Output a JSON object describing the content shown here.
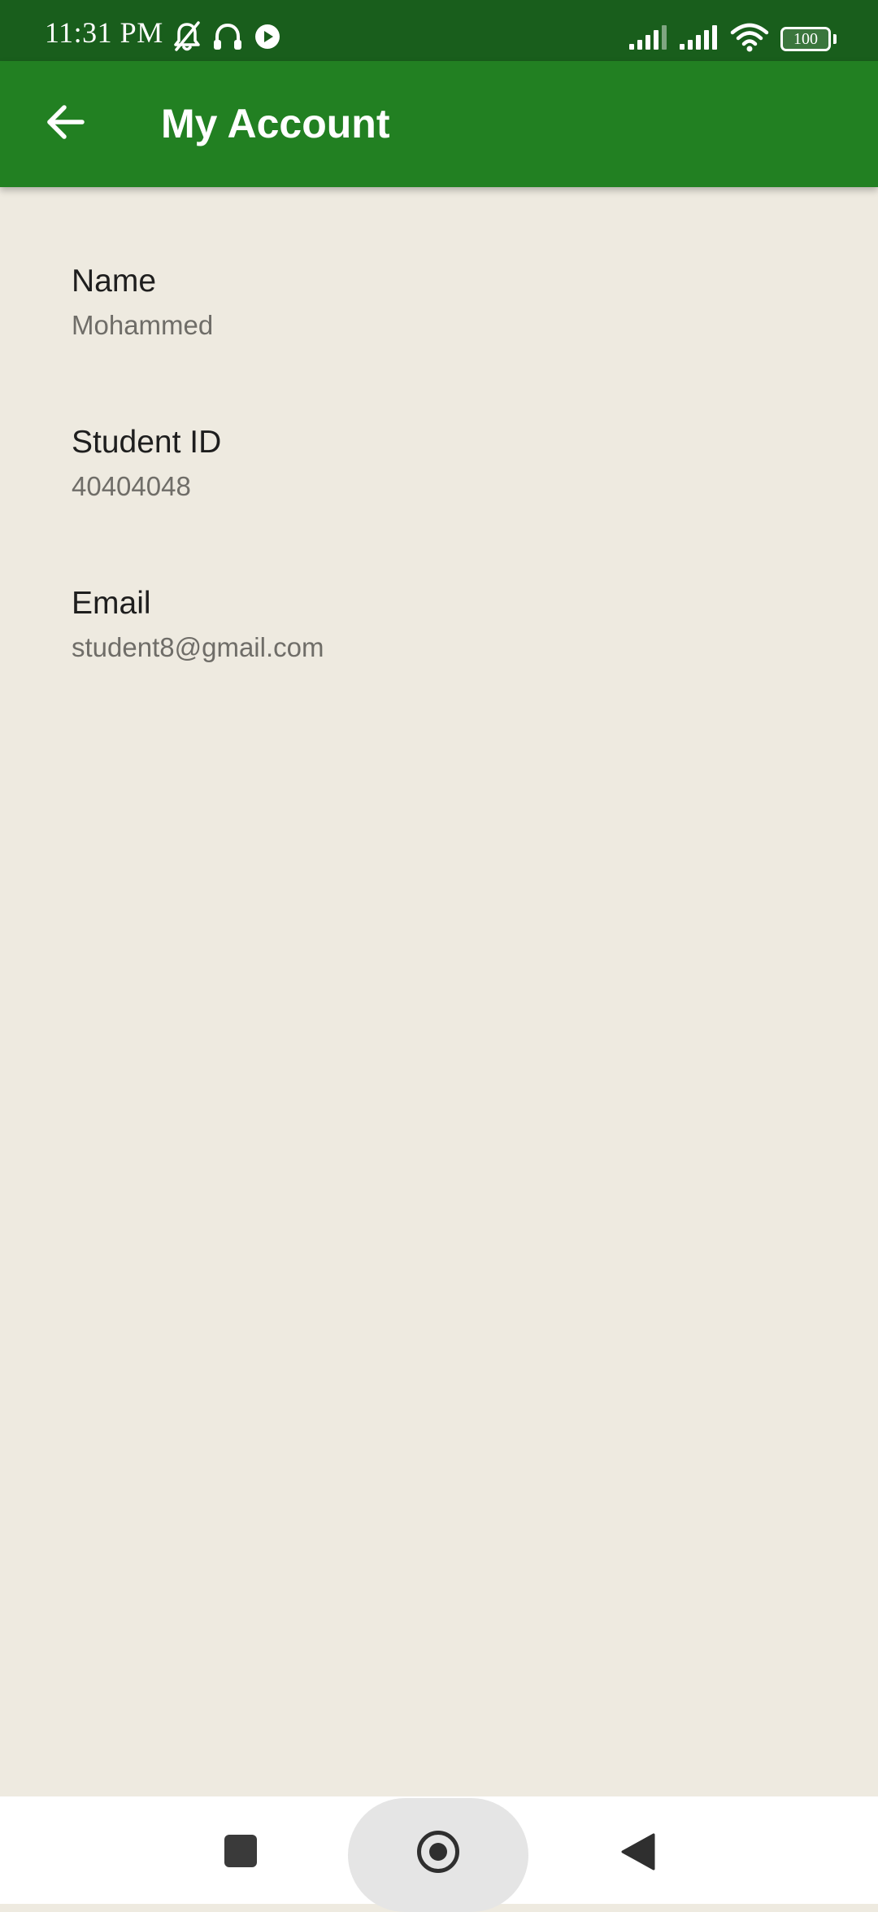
{
  "status_bar": {
    "time": "11:31 PM",
    "battery_level": "100",
    "icons_left": [
      "bell-off-icon",
      "headphones-icon",
      "play-circle-icon"
    ],
    "icons_right": [
      "signal-icon",
      "signal-icon",
      "wifi-icon",
      "battery-icon"
    ]
  },
  "app_bar": {
    "title": "My Account",
    "back_icon": "arrow-left-icon"
  },
  "account": {
    "fields": [
      {
        "label": "Name",
        "value": "Mohammed"
      },
      {
        "label": "Student ID",
        "value": "40404048"
      },
      {
        "label": "Email",
        "value": "student8@gmail.com"
      }
    ]
  },
  "nav_bar": {
    "buttons": [
      "recents-icon",
      "home-icon",
      "back-triangle-icon"
    ]
  },
  "colors": {
    "status_bar": "#195E1C",
    "app_bar": "#228022",
    "background": "#EEEAE0",
    "label_text": "#1E1E1E",
    "value_text": "#6F6D68"
  }
}
